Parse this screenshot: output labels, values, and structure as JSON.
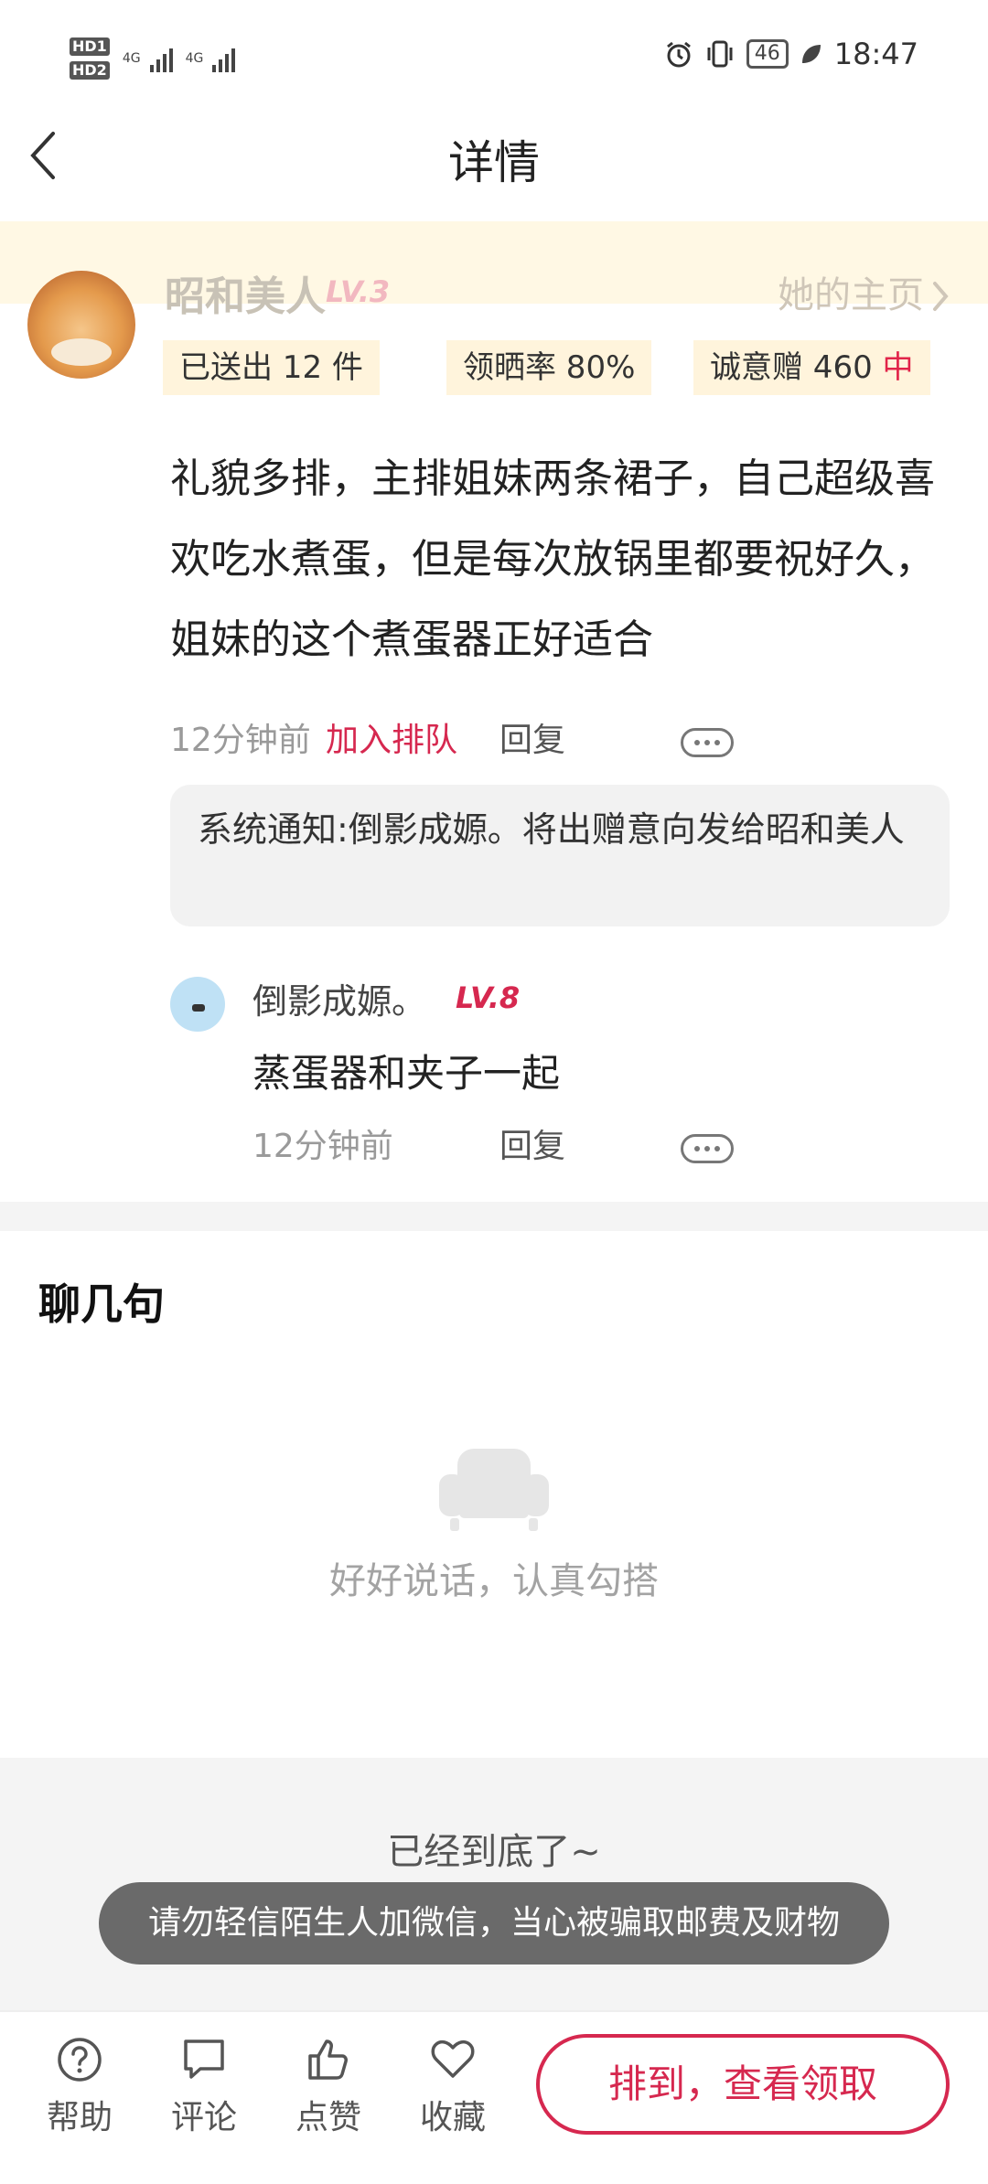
{
  "status_bar": {
    "sim1": "HD",
    "sim1_num": "1",
    "sim2": "HD",
    "sim2_num": "2",
    "net1": "4G",
    "net2": "4G",
    "battery": "46",
    "time": "18:47"
  },
  "header": {
    "title": "详情"
  },
  "profile": {
    "name": "昭和美人",
    "level": "LV.3",
    "homepage_link": "她的主页",
    "tags": [
      {
        "text": "已送出 12 件"
      },
      {
        "text": "领晒率 80%"
      },
      {
        "text": "诚意赠 460 ",
        "highlight": "中"
      }
    ]
  },
  "post": {
    "text": "礼貌多排，主排姐妹两条裙子，自己超级喜欢吃水煮蛋，但是每次放锅里都要祝好久，姐妹的这个煮蛋器正好适合",
    "time": "12分钟前",
    "join_queue": "加入排队",
    "reply": "回复"
  },
  "system_notice": "系统通知:倒影成嫄。将出赠意向发给昭和美人",
  "comment": {
    "user": "倒影成嫄。",
    "level": "LV.8",
    "text": "蒸蛋器和夹子一起",
    "time": "12分钟前",
    "reply": "回复"
  },
  "chat": {
    "title": "聊几句",
    "empty_text": "好好说话，认真勾搭"
  },
  "bottom_text": "已经到底了~",
  "toast": "请勿轻信陌生人加微信，当心被骗取邮费及财物",
  "tabbar": {
    "help": "帮助",
    "comment": "评论",
    "like": "点赞",
    "favorite": "收藏",
    "cta": "排到，查看领取"
  },
  "colors": {
    "accent": "#d6284f",
    "band": "#fff8e4",
    "tag_bg": "#fff4dc"
  }
}
